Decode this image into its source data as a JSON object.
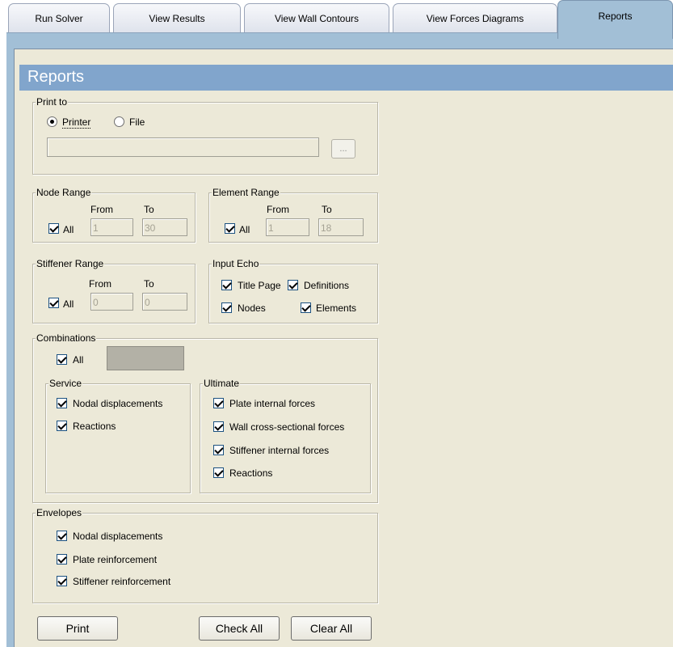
{
  "tabs": [
    "Run Solver",
    "View Results",
    "View Wall Contours",
    "View Forces Diagrams",
    "Reports"
  ],
  "active_tab": "Reports",
  "title": "Reports",
  "print_to": {
    "legend": "Print to",
    "options": [
      "Printer",
      "File"
    ],
    "selected": "Printer",
    "file_path": "",
    "browse_label": "..."
  },
  "node_range": {
    "legend": "Node Range",
    "all_label": "All",
    "all_checked": true,
    "from_label": "From",
    "to_label": "To",
    "from": "1",
    "to": "30"
  },
  "element_range": {
    "legend": "Element Range",
    "all_label": "All",
    "all_checked": true,
    "from_label": "From",
    "to_label": "To",
    "from": "1",
    "to": "18"
  },
  "stiffener_range": {
    "legend": "Stiffener Range",
    "all_label": "All",
    "all_checked": true,
    "from_label": "From",
    "to_label": "To",
    "from": "0",
    "to": "0"
  },
  "input_echo": {
    "legend": "Input Echo",
    "items": [
      {
        "label": "Title Page",
        "checked": true
      },
      {
        "label": "Definitions",
        "checked": true
      },
      {
        "label": "Nodes",
        "checked": true
      },
      {
        "label": "Elements",
        "checked": true
      }
    ]
  },
  "combinations": {
    "legend": "Combinations",
    "all_label": "All",
    "all_checked": true,
    "service": {
      "legend": "Service",
      "items": [
        {
          "label": "Nodal displacements",
          "checked": true
        },
        {
          "label": "Reactions",
          "checked": true
        }
      ]
    },
    "ultimate": {
      "legend": "Ultimate",
      "items": [
        {
          "label": "Plate internal forces",
          "checked": true
        },
        {
          "label": "Wall cross-sectional forces",
          "checked": true
        },
        {
          "label": "Stiffener internal forces",
          "checked": true
        },
        {
          "label": "Reactions",
          "checked": true
        }
      ]
    }
  },
  "envelopes": {
    "legend": "Envelopes",
    "items": [
      {
        "label": "Nodal displacements",
        "checked": true
      },
      {
        "label": "Plate reinforcement",
        "checked": true
      },
      {
        "label": "Stiffener reinforcement",
        "checked": true
      }
    ]
  },
  "buttons": {
    "print": "Print",
    "check_all": "Check All",
    "clear_all": "Clear All"
  },
  "colors": {
    "accent": "#81a5cc",
    "panel": "#ece9d8",
    "tab_active": "#a2bfd6"
  }
}
